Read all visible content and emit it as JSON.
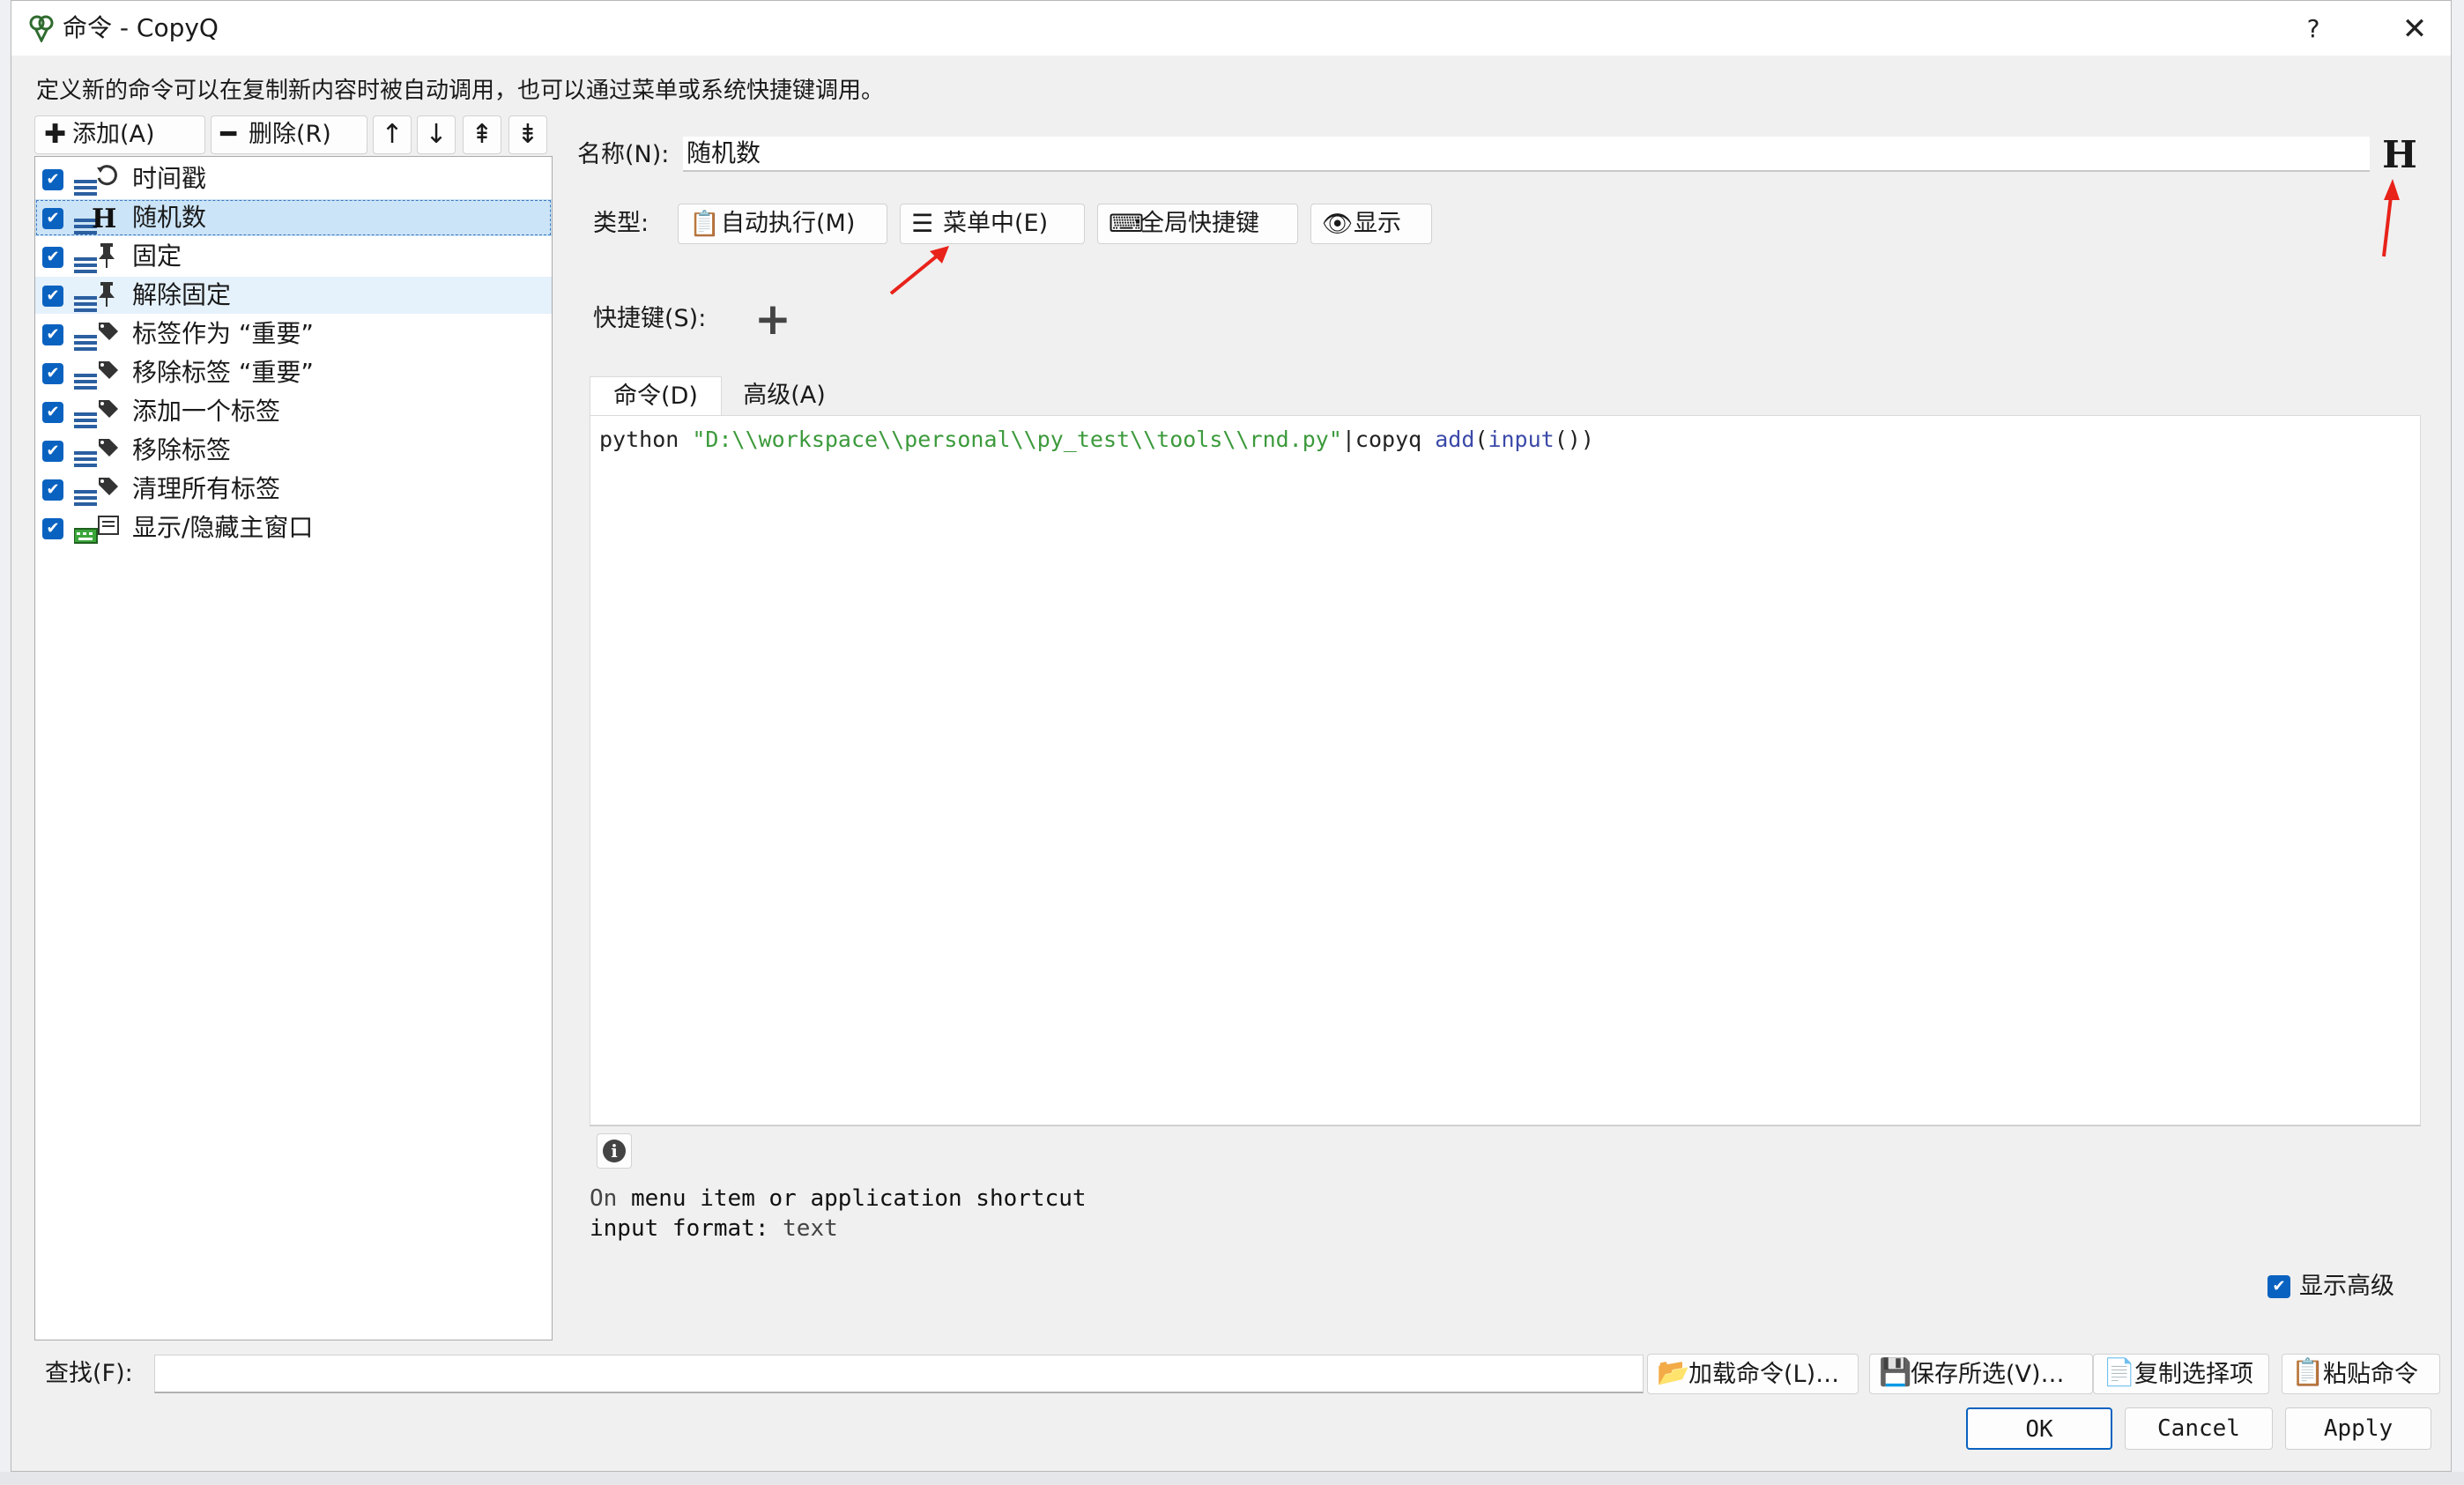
{
  "window": {
    "title": "命令 - CopyQ",
    "help_label": "?",
    "close_label": "✕"
  },
  "description": "定义新的命令可以在复制新内容时被自动调用，也可以通过菜单或系统快捷键调用。",
  "list_toolbar": {
    "add_label": "添加(A)",
    "remove_label": "删除(R)",
    "move_up": "↑",
    "move_down": "↓",
    "move_top": "⇞",
    "move_bottom": "⇟"
  },
  "commands": [
    {
      "label": "时间戳",
      "checked": true,
      "icon": "clock-icon"
    },
    {
      "label": "随机数",
      "checked": true,
      "icon": "h-icon"
    },
    {
      "label": "固定",
      "checked": true,
      "icon": "pin-icon"
    },
    {
      "label": "解除固定",
      "checked": true,
      "icon": "pin-icon"
    },
    {
      "label": "标签作为 “重要”",
      "checked": true,
      "icon": "tag-icon"
    },
    {
      "label": "移除标签 “重要”",
      "checked": true,
      "icon": "tag-icon"
    },
    {
      "label": "添加一个标签",
      "checked": true,
      "icon": "tag-icon"
    },
    {
      "label": "移除标签",
      "checked": true,
      "icon": "tag-icon"
    },
    {
      "label": "清理所有标签",
      "checked": true,
      "icon": "tag-icon"
    },
    {
      "label": "显示/隐藏主窗口",
      "checked": true,
      "icon": "keyboard-icon"
    }
  ],
  "form": {
    "name_label": "名称(N):",
    "name_value": "随机数",
    "icon_glyph": "H",
    "type_label": "类型:",
    "types": [
      {
        "label": "自动执行(M)",
        "icon": "clipboard-icon"
      },
      {
        "label": "菜单中(E)",
        "icon": "menu-icon"
      },
      {
        "label": "全局快捷键",
        "icon": "keyboard-icon"
      },
      {
        "label": "显示",
        "icon": "eye-icon"
      }
    ],
    "shortcut_label": "快捷键(S):",
    "shortcut_add": "+"
  },
  "tabs": [
    {
      "label": "命令(D)",
      "active": true
    },
    {
      "label": "高级(A)",
      "active": false
    }
  ],
  "editor": {
    "cmd": "python ",
    "path": "\"D:\\\\workspace\\\\personal\\\\py_test\\\\tools\\\\rnd.py\"",
    "pipe": "|copyq ",
    "fn1": "add",
    "p1": "(",
    "fn2": "input",
    "p2": "())"
  },
  "info": {
    "line1_key": "On ",
    "line1_val": "menu item or application shortcut",
    "line2_key": "input format: ",
    "line2_val": "text"
  },
  "show_advanced_label": "显示高级",
  "search_label": "查找(F):",
  "search_value": "",
  "bottom_buttons": {
    "load": "加载命令(L)…",
    "save": "保存所选(V)…",
    "copy": "复制选择项",
    "paste": "粘贴命令"
  },
  "dialog_buttons": {
    "ok": "OK",
    "cancel": "Cancel",
    "apply": "Apply"
  },
  "colors": {
    "accent": "#0a62c0",
    "selection": "#cce4f7",
    "annotation_arrow": "#e8231a"
  }
}
